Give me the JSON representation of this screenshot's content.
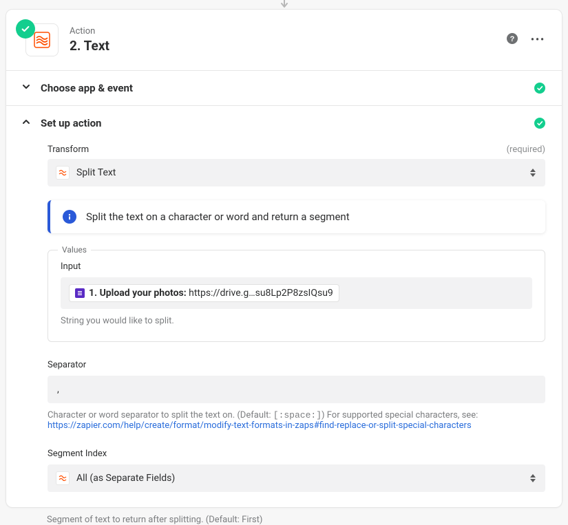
{
  "header": {
    "label": "Action",
    "title": "2. Text"
  },
  "sections": {
    "choose": {
      "title": "Choose app & event"
    },
    "setup": {
      "title": "Set up action"
    }
  },
  "transform": {
    "label": "Transform",
    "required": "(required)",
    "value": "Split Text",
    "info": "Split the text on a character or word and return a segment"
  },
  "values": {
    "legend": "Values",
    "input_label": "Input",
    "pill_label": "1. Upload your photos:",
    "pill_value": "https://drive.g…su8Lp2P8zsIQsu9",
    "input_hint": "String you would like to split."
  },
  "separator": {
    "label": "Separator",
    "value": ",",
    "hint_pre": "Character or word separator to split the text on. (Default: ",
    "hint_code": "[:space:]",
    "hint_post": ") For supported special characters, see:",
    "link": "https://zapier.com/help/create/format/modify-text-formats-in-zaps#find-replace-or-split-special-characters"
  },
  "segment": {
    "label": "Segment Index",
    "value": "All (as Separate Fields)",
    "hint": "Segment of text to return after splitting. (Default: First)"
  }
}
